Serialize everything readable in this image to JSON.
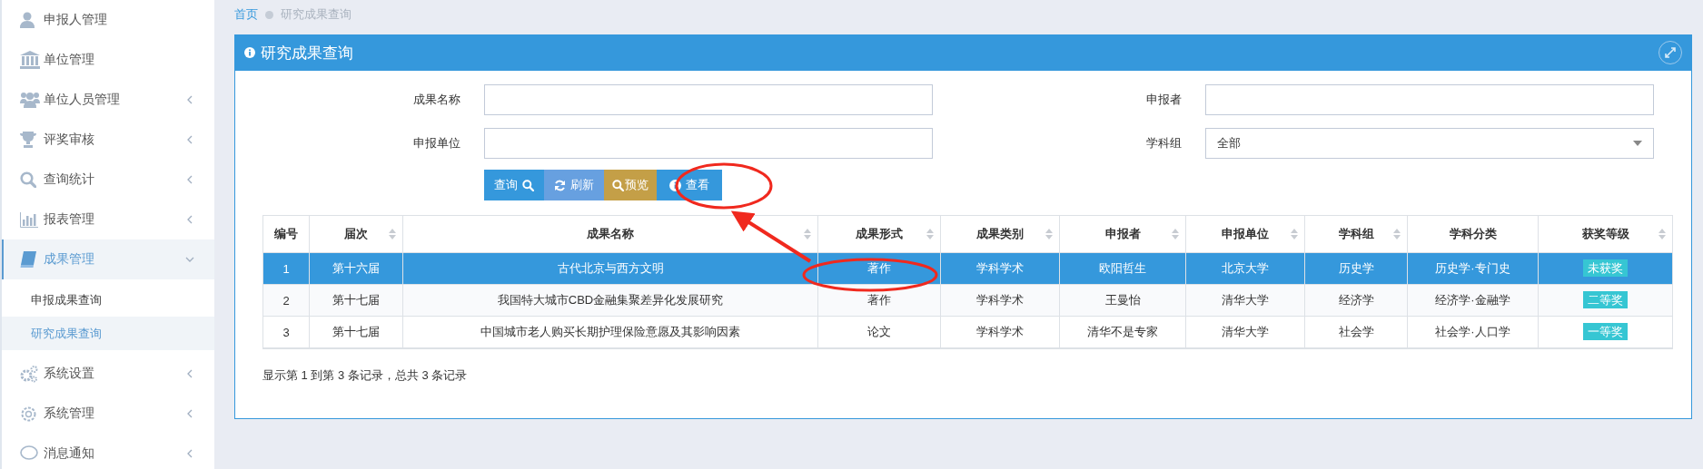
{
  "sidebar": {
    "items": [
      {
        "label": "申报人管理",
        "selected": false
      },
      {
        "label": "单位管理",
        "selected": false
      },
      {
        "label": "单位人员管理",
        "selected": false,
        "expanded": false
      },
      {
        "label": "评奖审核",
        "selected": false,
        "expanded": false
      },
      {
        "label": "查询统计",
        "selected": false,
        "expanded": false
      },
      {
        "label": "报表管理",
        "selected": false,
        "expanded": false
      },
      {
        "label": "成果管理",
        "selected": true,
        "expanded": true,
        "children": [
          {
            "label": "申报成果查询",
            "selected": false
          },
          {
            "label": "研究成果查询",
            "selected": true
          }
        ]
      },
      {
        "label": "系统设置",
        "selected": false,
        "expanded": false
      },
      {
        "label": "系统管理",
        "selected": false,
        "expanded": false
      },
      {
        "label": "消息通知",
        "selected": false,
        "expanded": false
      }
    ]
  },
  "breadcrumb": [
    "首页",
    "研究成果查询"
  ],
  "panel": {
    "title": "研究成果查询",
    "fields": [
      {
        "label": "成果名称",
        "kind": "text"
      },
      {
        "label": "申报者",
        "kind": "text"
      },
      {
        "label": "申报单位",
        "kind": "text"
      },
      {
        "label": "学科组",
        "kind": "select",
        "value": "全部"
      }
    ],
    "buttons": [
      {
        "label": "查询",
        "kind": "search"
      },
      {
        "label": "刷新",
        "kind": "refresh"
      },
      {
        "label": "预览",
        "kind": "preview"
      },
      {
        "label": "查看",
        "kind": "view"
      }
    ],
    "table": {
      "columns": [
        {
          "label": "编号",
          "sortable": false
        },
        {
          "label": "届次",
          "sortable": true
        },
        {
          "label": "成果名称",
          "sortable": true
        },
        {
          "label": "成果形式",
          "sortable": true
        },
        {
          "label": "成果类别",
          "sortable": true
        },
        {
          "label": "申报者",
          "sortable": true
        },
        {
          "label": "申报单位",
          "sortable": true
        },
        {
          "label": "学科组",
          "sortable": true
        },
        {
          "label": "学科分类",
          "sortable": false
        },
        {
          "label": "获奖等级",
          "sortable": true
        }
      ],
      "rows": [
        {
          "selected": true,
          "cells": [
            "1",
            "第十六届",
            "古代北京与西方文明",
            "著作",
            "学科学术",
            "欧阳哲生",
            "北京大学",
            "历史学",
            "历史学·专门史",
            "未获奖"
          ]
        },
        {
          "selected": false,
          "cells": [
            "2",
            "第十七届",
            "我国特大城市CBD金融集聚差异化发展研究",
            "著作",
            "学科学术",
            "王曼怡",
            "清华大学",
            "经济学",
            "经济学·金融学",
            "二等奖"
          ]
        },
        {
          "selected": false,
          "cells": [
            "3",
            "第十七届",
            "中国城市老人购买长期护理保险意愿及其影响因素",
            "论文",
            "学科学术",
            "清华不是专家",
            "清华大学",
            "社会学",
            "社会学·人口学",
            "一等奖"
          ]
        }
      ]
    },
    "footer": "显示第 1 到第 3 条记录，总共 3 条记录"
  }
}
